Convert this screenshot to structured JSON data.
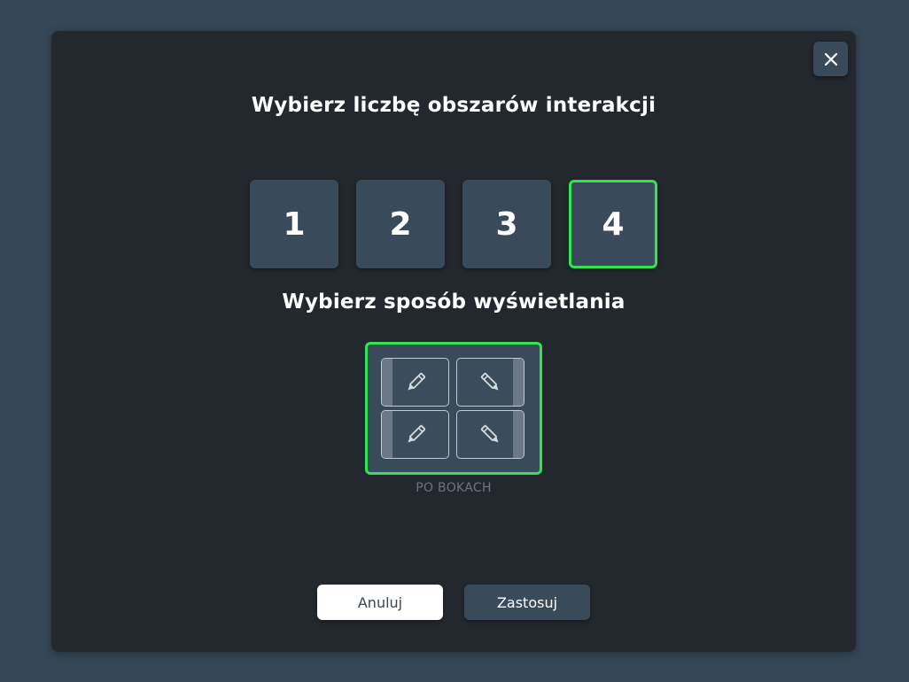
{
  "dialog": {
    "close_icon": "close-icon",
    "title_count": "Wybierz liczbę obszarów interakcji",
    "count_options": [
      "1",
      "2",
      "3",
      "4"
    ],
    "selected_count": "4",
    "title_display": "Wybierz sposób wyświetlania",
    "display_option": {
      "label": "PO BOKACH",
      "cell_icon": "pencil-icon",
      "selected": true
    },
    "cancel_label": "Anuluj",
    "apply_label": "Zastosuj"
  },
  "colors": {
    "background": "#364757",
    "modal": "#23272e",
    "tile": "#394a5b",
    "accent": "#2ee652"
  }
}
